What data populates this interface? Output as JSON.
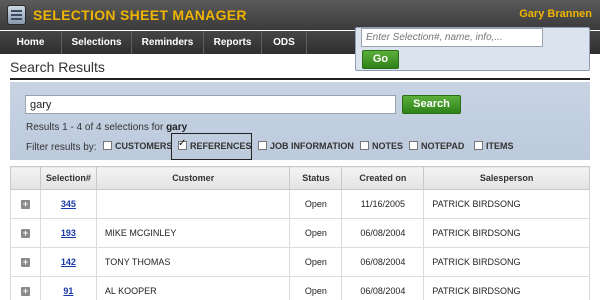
{
  "header": {
    "app_title": "SELECTION SHEET MANAGER",
    "user_name": "Gary Brannen",
    "logo_icon": "selection-sheet-logo-icon"
  },
  "nav": {
    "items": [
      "Home",
      "Selections",
      "Reminders",
      "Reports",
      "ODS"
    ]
  },
  "quick_search": {
    "placeholder": "Enter Selection#, name, info,...",
    "button_label": "Go"
  },
  "page": {
    "title": "Search Results"
  },
  "search": {
    "value": "gary",
    "button_label": "Search",
    "summary_prefix": "Results 1 - 4 of 4 selections for ",
    "summary_term": "gary",
    "filter_label": "Filter results by:",
    "filters": [
      {
        "label": "CUSTOMERS",
        "checked": false
      },
      {
        "label": "REFERENCES",
        "checked": true
      },
      {
        "label": "JOB INFORMATION",
        "checked": false
      },
      {
        "label": "NOTES",
        "checked": false
      },
      {
        "label": "NOTEPAD",
        "checked": false
      },
      {
        "label": "ITEMS",
        "checked": false
      }
    ]
  },
  "table": {
    "columns": [
      "Selection#",
      "Customer",
      "Status",
      "Created on",
      "Salesperson"
    ],
    "rows": [
      {
        "selection": "345",
        "customer": "",
        "status": "Open",
        "created": "11/16/2005",
        "salesperson": "PATRICK BIRDSONG"
      },
      {
        "selection": "193",
        "customer": "MIKE MCGINLEY",
        "status": "Open",
        "created": "06/08/2004",
        "salesperson": "PATRICK BIRDSONG"
      },
      {
        "selection": "142",
        "customer": "TONY THOMAS",
        "status": "Open",
        "created": "06/08/2004",
        "salesperson": "PATRICK BIRDSONG"
      },
      {
        "selection": "91",
        "customer": "AL KOOPER",
        "status": "Open",
        "created": "06/08/2004",
        "salesperson": "PATRICK BIRDSONG"
      }
    ]
  },
  "colors": {
    "brand_gold": "#f0b400",
    "button_green": "#3f9626",
    "panel_blue": "#c3d0e1",
    "link_blue": "#1a3aa8"
  }
}
